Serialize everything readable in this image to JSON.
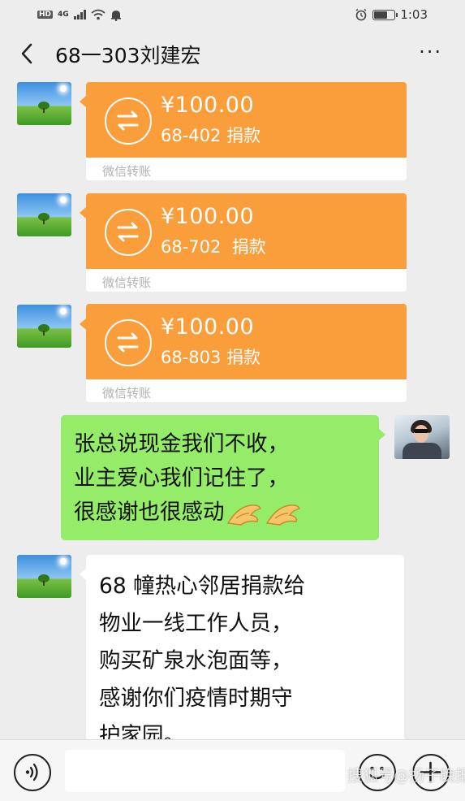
{
  "status_bar": {
    "network_tag": "HD",
    "network_type": "4G",
    "time": "1:03",
    "battery_level": 0.6
  },
  "header": {
    "title": "68一303刘建宏",
    "back_icon": "chevron-left-icon",
    "more_icon": "ellipsis-icon",
    "more_label": "···"
  },
  "colors": {
    "transfer": "#fa9d3b",
    "sent_bubble": "#95ec69",
    "received_bubble": "#ffffff",
    "background": "#ededed"
  },
  "messages": [
    {
      "type": "transfer",
      "amount": "¥100.00",
      "note": "68-402 捐款",
      "footer": "微信转账"
    },
    {
      "type": "transfer",
      "amount": "¥100.00",
      "note": "68-702  捐款",
      "footer": "微信转账"
    },
    {
      "type": "transfer",
      "amount": "¥100.00",
      "note": "68-803 捐款",
      "footer": "微信转账"
    },
    {
      "type": "text",
      "direction": "sent",
      "lines": [
        "张总说现金我们不收，",
        "业主爱心我们记住了，",
        "很感谢也很感动"
      ],
      "emoji": "pinched-fingers-icon"
    },
    {
      "type": "text",
      "direction": "received",
      "lines": [
        "68 幢热心邻居捐款给",
        "物业一线工作人员，",
        "购买矿泉水泡面等，",
        "感谢你们疫情时期守",
        "护家园。"
      ]
    }
  ],
  "input_bar": {
    "voice_icon": "voice-icon",
    "emoji_icon": "smiley-icon",
    "plus_icon": "plus-icon"
  },
  "watermark": "搜狐号@扬子晚报"
}
